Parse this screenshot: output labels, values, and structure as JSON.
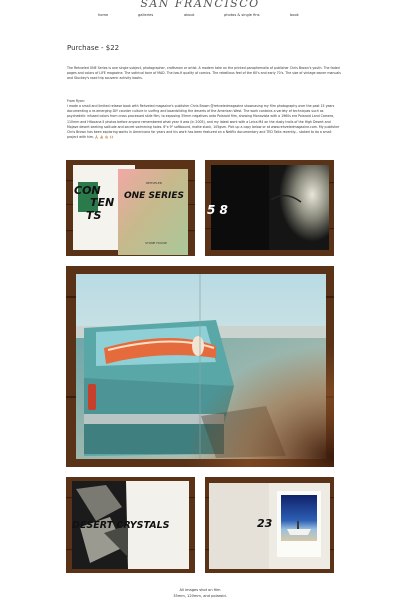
{
  "site": {
    "title": "SAN FRANCISCO"
  },
  "nav": {
    "items": [
      {
        "label": "home"
      },
      {
        "label": "galleries"
      },
      {
        "label": "about"
      },
      {
        "label": "photos & single fins"
      },
      {
        "label": "book"
      }
    ]
  },
  "purchase": {
    "label": "Purchase  - $22"
  },
  "description": "The Rehveled ONE Series is one single subject, photographer, craftsman or artist. A modern take on the printed paraphernalia of publisher Chris Brown's youth. The faded pages and colors of LIFE magazine. The satirical tone of MAD. The low-fi quality of comics. The rebellious feel of the 60's and early 70's. The size of vintage owner manuals and Stuckey's road trip souvenir activity books.",
  "from_ryan": {
    "heading": "From Ryan:",
    "body": "I made a small and limited release book with Rehveled magazine's publisher Chris Brown @rehveledmagazine showcasing my film photography over the past 15 years documenting a re-emerging DIY counter culture in surfing and boardsliding the deserts of the American West. The work contains a variety of techniques such as psychedelic infused colors from cross processed slide film, to exposing 35mm negatives onto Polaroid film, showing Monavista with a 1960s era Polaroid Land Camera, 110mm and Hitocana II photos before anyone remembered what year it was (in 2005), and my latest work with a Leica M4 on the dusty trails of the High Desert and Mojave desert seeking solitude and secret swimming holes. 6\"x 9\" softbound, matte stock, 105gsm. Pick up a copy below or at www.rehveledmagazine.com. My publisher Chris Brown has been exploring works in Americana for years and his work has been featured on a Netflix documentary and TED Talks recently... stoked to do a small project with him. 🙏🏼 👍🏼 🤙🏼 🙌🏼"
  },
  "photos": {
    "p1": {
      "text1": "CON",
      "text2": "TEN",
      "text3": "TS",
      "cover_title": "ONE SERIES",
      "cover_sub": "STONE HOUSE",
      "cover_small": "REHVELED"
    },
    "p2": {
      "text": "5 8"
    },
    "p4": {
      "text": "DESERT  CRYSTALS"
    },
    "p5": {
      "text": "23"
    }
  },
  "footer": {
    "line1": "All images shot on film",
    "line2": "35mm, 120mm, and polaroid."
  },
  "colors": {
    "wood": "#5a3218",
    "text": "#333333",
    "car": "#5aa7a8"
  }
}
